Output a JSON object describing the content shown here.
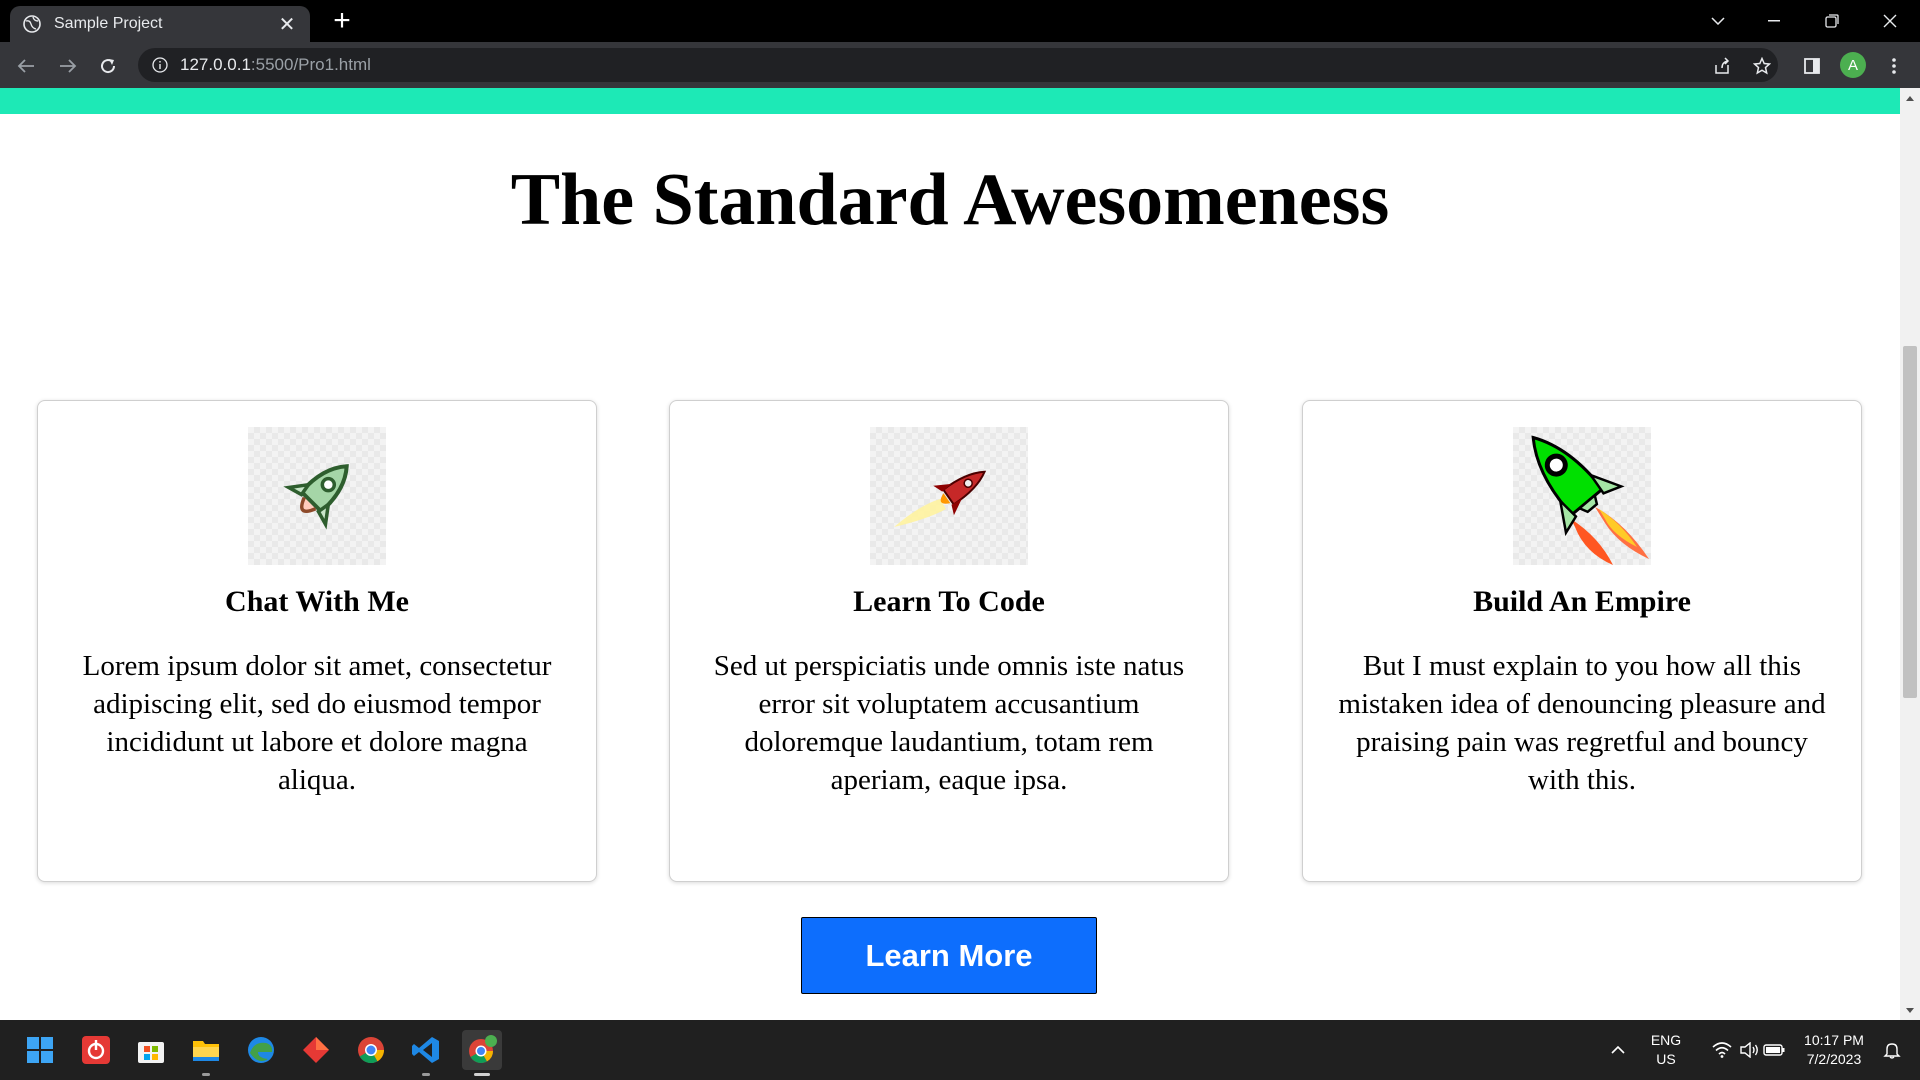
{
  "browser": {
    "tab_title": "Sample Project",
    "url_host": "127.0.0.1",
    "url_path": ":5500/Pro1.html",
    "profile_initial": "A"
  },
  "page": {
    "heading": "The Standard Awesomeness",
    "accent_color": "#1de9b6",
    "cards": [
      {
        "icon": "rocket-outline-green-icon",
        "title": "Chat With Me",
        "text": "Lorem ipsum dolor sit amet, consectetur adipiscing elit, sed do eiusmod tempor incididunt ut labore et dolore magna aliqua."
      },
      {
        "icon": "rocket-red-icon",
        "title": "Learn To Code",
        "text": "Sed ut perspiciatis unde omnis iste natus error sit voluptatem accusantium doloremque laudantium, totam rem aperiam, eaque ipsa."
      },
      {
        "icon": "rocket-green-flame-icon",
        "title": "Build An Empire",
        "text": "But I must explain to you how all this mistaken idea of denouncing pleasure and praising pain was regretful and bouncy with this."
      }
    ],
    "cta_label": "Learn More",
    "cta_color": "#0d6efd"
  },
  "taskbar": {
    "language_line1": "ENG",
    "language_line2": "US",
    "time": "10:17 PM",
    "date": "7/2/2023"
  }
}
